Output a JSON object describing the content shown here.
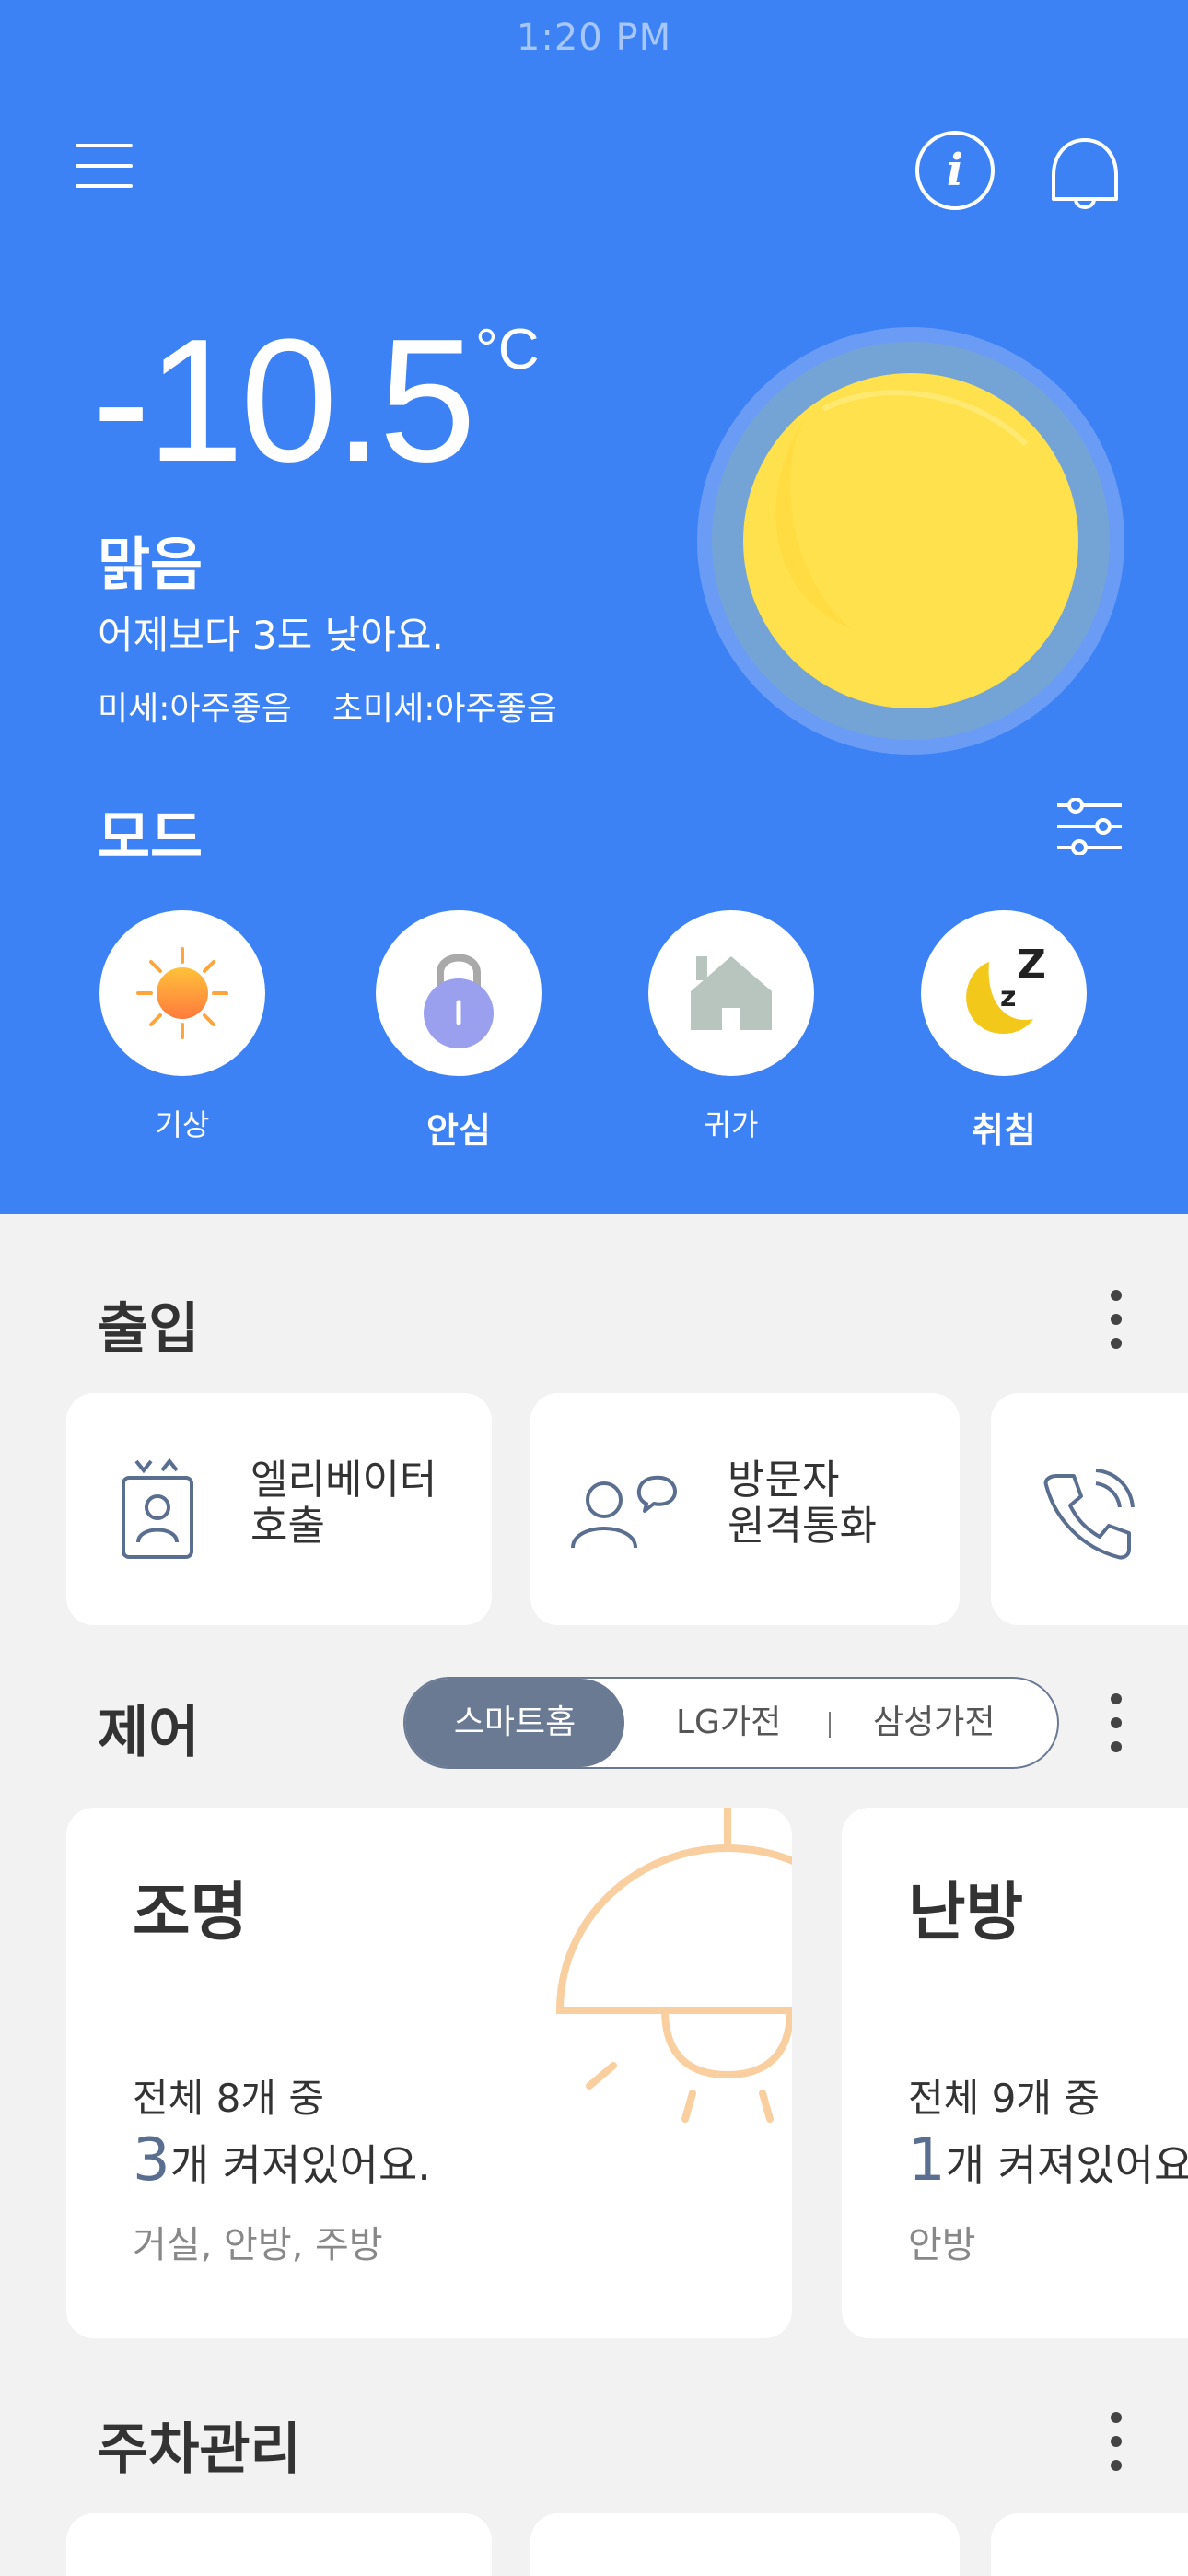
{
  "status_bar": {
    "time": "1:20 PM"
  },
  "weather": {
    "temperature": "-10.5",
    "unit": "°C",
    "condition": "맑음",
    "compare": "어제보다 3도 낮아요.",
    "fine_dust": "미세:아주좋음",
    "ultra_fine_dust": "초미세:아주좋음",
    "icon": "sun-icon"
  },
  "mode": {
    "title": "모드",
    "items": [
      {
        "label": "기상",
        "icon": "sunrise-icon"
      },
      {
        "label": "안심",
        "icon": "lock-icon"
      },
      {
        "label": "귀가",
        "icon": "house-icon"
      },
      {
        "label": "취침",
        "icon": "moon-sleep-icon"
      }
    ]
  },
  "entry": {
    "title": "출입",
    "items": [
      {
        "label_line1": "엘리베이터",
        "label_line2": "호출",
        "icon": "elevator-icon"
      },
      {
        "label_line1": "방문자",
        "label_line2": "원격통화",
        "icon": "visitor-call-icon"
      },
      {
        "icon": "phone-icon"
      }
    ]
  },
  "control": {
    "title": "제어",
    "tabs": [
      "스마트홈",
      "LG가전",
      "삼성가전"
    ],
    "active_tab": "스마트홈",
    "cards": [
      {
        "title": "조명",
        "total": "전체 8개 중",
        "count": "3",
        "on_text": "개 켜져있어요.",
        "rooms": "거실, 안방, 주방",
        "icon": "lamp-icon"
      },
      {
        "title": "난방",
        "total": "전체 9개 중",
        "count": "1",
        "on_text": "개 켜져있어요.",
        "rooms": "안방"
      }
    ]
  },
  "parking": {
    "title": "주차관리"
  },
  "colors": {
    "brand_blue": "#3d82f4",
    "sun_yellow": "#ffe14d",
    "slate": "#6a7a93",
    "lamp_orange": "#f9cfa0"
  }
}
